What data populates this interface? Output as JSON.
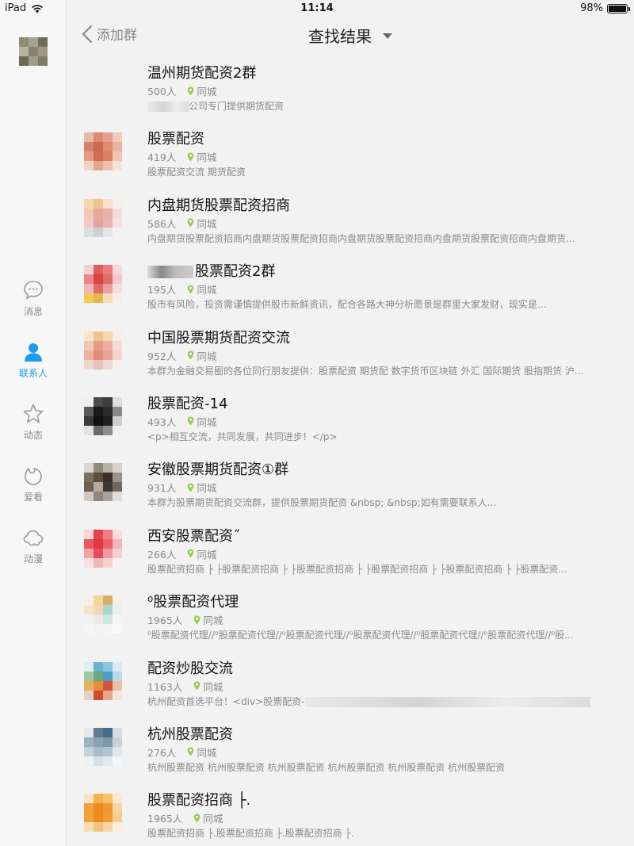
{
  "status": {
    "device": "iPad",
    "time": "11:14",
    "battery": "98%",
    "battery_level": 0.98
  },
  "sidebar": {
    "avatar_colors": [
      "#8d8c6e",
      "#a6a38d",
      "#6e6c59",
      "#b5b29e",
      "#85836a",
      "#9c9a83",
      "#6b6a55",
      "#a09f8a",
      "#7f7d68"
    ],
    "items": [
      {
        "label": "消息",
        "icon": "message-icon",
        "active": false
      },
      {
        "label": "联系人",
        "icon": "contact-icon",
        "active": true
      },
      {
        "label": "动态",
        "icon": "star-icon",
        "active": false
      },
      {
        "label": "爱看",
        "icon": "fire-icon",
        "active": false
      },
      {
        "label": "动漫",
        "icon": "cloud-icon",
        "active": false
      }
    ]
  },
  "header": {
    "back_label": "添加群",
    "title": "查找结果"
  },
  "results": [
    {
      "name": "温州期货配资2群",
      "members": "500人",
      "location": "同城",
      "desc": "公司专门提供期货配资",
      "desc_redact_before": true,
      "colors": []
    },
    {
      "name": "股票配资",
      "members": "419人",
      "location": "同城",
      "desc": "股票配资交流 期货配资",
      "colors": [
        "#e9b9a7",
        "#d98a71",
        "#e59f8a",
        "#f0cbbd",
        "#d7836a",
        "#c96a51",
        "#e08b6e",
        "#eab3a0",
        "#e79a84",
        "#d06b54",
        "#dc7d64",
        "#efc4b3",
        "#f2d5c8",
        "#e5a68f",
        "#eec0ad",
        "#f6e1d7"
      ]
    },
    {
      "name": "内盘期货股票配资招商",
      "members": "586人",
      "location": "同城",
      "desc": "内盘期货股票配资招商内盘期货股票配资招商内盘期货股票配资招商内盘期货股票配资招商内盘期货...",
      "colors": [
        "#f6d9a8",
        "#f0c38a",
        "#f4e2cf",
        "#f8ecec",
        "#eec7b7",
        "#e9a79a",
        "#e2b2ab",
        "#f3dcdc",
        "#f1c7c7",
        "#e6a1a1",
        "#e8b3b3",
        "#f6e0e0",
        "#dedede",
        "#d0d0d0",
        "#e4e4e4",
        "#f2f2f2"
      ]
    },
    {
      "name": "股票配资2群",
      "name_redact_before": true,
      "members": "195人",
      "location": "同城",
      "desc": "股市有风险，投资需谨慎提供股市新鲜资讯，配合各路大神分析愿景是群里大家发财，现实是",
      "desc_redact_after": true,
      "colors": [
        "#f3d2d2",
        "#e35b5b",
        "#ea7d7d",
        "#f5d8d8",
        "#e98a8a",
        "#d94545",
        "#e26a6a",
        "#f3c8c8",
        "#f1b7b7",
        "#df6a6a",
        "#eaa0a0",
        "#f6dede",
        "#f6c95a",
        "#e8b44b",
        "#f3dcb6",
        "#f6eee6"
      ]
    },
    {
      "name": "中国股票期货配资交流",
      "members": "952人",
      "location": "同城",
      "desc": "本群为金融交易圈的各位同行朋友提供：股票配资 期货配 数字货币区块链 外汇 国际期货 股指期货 沪...",
      "colors": [
        "#f9e6c9",
        "#f2c48c",
        "#f6d5ae",
        "#f9ece0",
        "#f0c7b2",
        "#e79a86",
        "#eab1a2",
        "#f5dcd3",
        "#ecb1a3",
        "#e38b7a",
        "#e8a595",
        "#f4d4cb",
        "#ebd6d0",
        "#e6c2b9",
        "#efd9d3",
        "#f8efec"
      ]
    },
    {
      "name": "股票配资-14",
      "members": "493人",
      "location": "同城",
      "desc": "<p>相互交流，共同发展，共同进步！</p>",
      "colors": [
        "#efefef",
        "#4a4a4a",
        "#3d3d3d",
        "#dcdcdc",
        "#5a5a5a",
        "#1a1a1a",
        "#2a2a2a",
        "#8a8a8a",
        "#3a3a3a",
        "#111111",
        "#202020",
        "#cfcfcf",
        "#e2e2e2",
        "#6a6a6a",
        "#8c8c8c",
        "#f0f0f0"
      ]
    },
    {
      "name": "安徽股票期货配资①群",
      "members": "931人",
      "location": "同城",
      "desc": "本群为股票期货配资交流群，提供股票期货配资 &nbsp; &nbsp;如有需要联系人",
      "desc_redact_after": true,
      "colors": [
        "#dad7d2",
        "#8f8a80",
        "#b9b2a6",
        "#d9d3ca",
        "#7a6e5e",
        "#5b4d3d",
        "#38302a",
        "#9c9288",
        "#6d5f52",
        "#b7aa9c",
        "#3e3834",
        "#6e6963",
        "#cfc9c1",
        "#8e8880",
        "#a7a19a",
        "#e1ddd8"
      ]
    },
    {
      "name": "西安股票配资˝",
      "members": "266人",
      "location": "同城",
      "desc": "股票配资招商 ├ ├股票配资招商 ├ ├股票配资招商 ├ ├股票配资招商 ├ ├股票配资招商 ├ ├股票配资...",
      "colors": [
        "#f7d6d6",
        "#e8414e",
        "#ef7f86",
        "#f9dedf",
        "#e75a64",
        "#e33544",
        "#ea5f69",
        "#f3b5b9",
        "#f0a4a9",
        "#e74c58",
        "#ee9aa0",
        "#f6cdd0",
        "#f8e1e2",
        "#f1b8bb",
        "#f6d1d3",
        "#fbefef"
      ]
    },
    {
      "name": "⁰股票配资代理",
      "members": "1965人",
      "location": "同城",
      "desc": "⁰股票配资代理//⁰股票配资代理//⁰股票配资代理//⁰股票配资代理//⁰股票配资代理//⁰股票配资代理//⁰股...",
      "colors": [
        "#f6f0e4",
        "#f3d79a",
        "#d7b06a",
        "#f6efe6",
        "#f4e5c9",
        "#f2d8b0",
        "#a9d8c9",
        "#e6f2ee",
        "#f1f1f1",
        "#eaeaea",
        "#cfe8df",
        "#f4f4f4",
        "#f6f6f6",
        "#f3f3f3",
        "#f5f5f5",
        "#f8f8f8"
      ]
    },
    {
      "name": "配资炒股交流",
      "members": "1163人",
      "location": "同城",
      "desc": "杭州配资首选平台！<div>股票配资-",
      "desc_redact_after": true,
      "colors": [
        "#e0eef2",
        "#66b3d6",
        "#8cc4de",
        "#dbeaf0",
        "#9bc9a5",
        "#6aa97e",
        "#4f9dc7",
        "#bcd9e4",
        "#e7b05a",
        "#e48c3e",
        "#d5553a",
        "#e9c0a8",
        "#e0d2c8",
        "#cf4e32",
        "#e6a58c",
        "#f2e7df"
      ]
    },
    {
      "name": "杭州股票配资",
      "members": "276人",
      "location": "同城",
      "desc": "杭州股票配资 杭州股票配资  杭州股票配资  杭州股票配资  杭州股票配资  杭州股票配资",
      "colors": [
        "#e4e9ec",
        "#5e7e94",
        "#3f6c86",
        "#d3dde3",
        "#9db1bf",
        "#8aa2b3",
        "#7d98ab",
        "#c7d3da",
        "#c5d1d9",
        "#a9bcc9",
        "#b3c4cf",
        "#e0e7eb",
        "#eef1f3",
        "#d7dfe4",
        "#e3e8ec",
        "#f3f5f6"
      ]
    },
    {
      "name": "股票配资招商 ├.",
      "members": "1965人",
      "location": "同城",
      "desc": "股票配资招商 ├.股票配资招商 ├.股票配资招商 ├.",
      "colors": [
        "#f7e4c7",
        "#f1b24c",
        "#f3c36e",
        "#f8e8cf",
        "#f0a13a",
        "#ec8b22",
        "#ee9a2c",
        "#f6d3a0",
        "#f0a33d",
        "#eb8a1f",
        "#ef9c33",
        "#f5cd93",
        "#f7dcb3",
        "#f4c47e",
        "#f6d6a8",
        "#faeedd"
      ]
    }
  ]
}
